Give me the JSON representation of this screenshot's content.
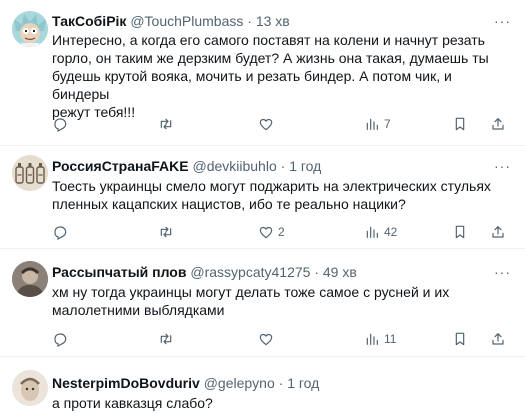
{
  "tweets": [
    {
      "name": "ТакСобіРік",
      "handle": "@TouchPlumbass",
      "time": "13 хв",
      "lines": [
        "Интересно, а когда его самого поставят на колени и начнут резать",
        "горло, он таким же дерзким будет? А жизнь она такая, думаешь ты",
        "будешь крутой вояка, мочить и резать биндер. А потом чик, и биндеры",
        "режут тебя!!!"
      ],
      "replies": "",
      "retweets": "",
      "likes": "",
      "views": "7"
    },
    {
      "name": "РоссияСтранаFAKE",
      "handle": "@devkiibuhlo",
      "time": "1 год",
      "lines": [
        "Тоесть украинцы смело могут поджарить на электрических стульях",
        "пленных кацапских нацистов, ибо те реально нацики?"
      ],
      "replies": "",
      "retweets": "",
      "likes": "2",
      "views": "42"
    },
    {
      "name": "Рассыпчатый плов",
      "handle": "@rassypcaty41275",
      "time": "49 хв",
      "lines": [
        "хм ну тогда украинцы могут делать тоже самое с русней и их",
        "малолетними выблядками"
      ],
      "replies": "",
      "retweets": "",
      "likes": "",
      "views": "11"
    },
    {
      "name": "NesterpimDoBovduriv",
      "handle": "@gelepyno",
      "time": "1 год",
      "lines": [
        "а проти кавказця слабо?"
      ]
    }
  ],
  "separator": "·",
  "more_label": "···",
  "colors": {
    "text": "#0f1419",
    "secondary": "#536471",
    "divider": "#eff3f4"
  }
}
